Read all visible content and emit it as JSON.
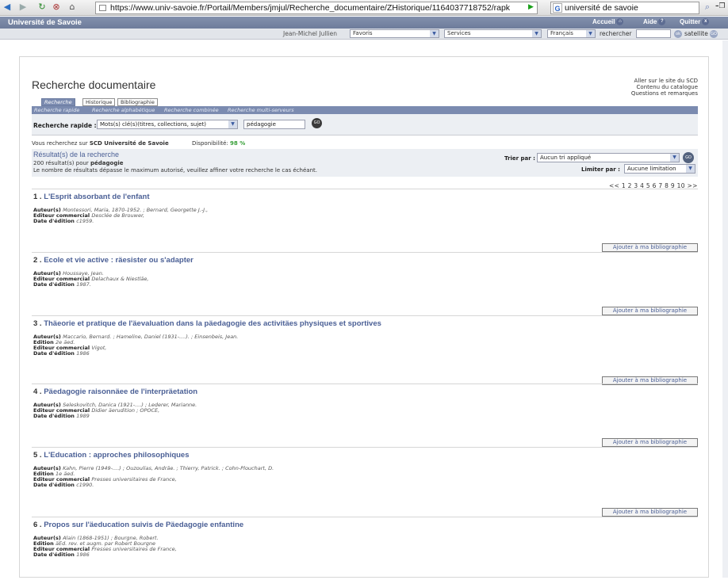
{
  "browser": {
    "url": "https://www.univ-savoie.fr/Portail/Members/jmjul/Recherche_documentaire/ZHistorique/1164037718752/rapk",
    "search_text": "université de savoie"
  },
  "site": {
    "title": "Université de Savoie",
    "links": [
      "Accueil",
      "Aide",
      "Quitter"
    ],
    "user": "Jean-Michel Jullien",
    "favorites": "Favoris",
    "services": "Services",
    "language": "Français",
    "search_label": "rechercher",
    "search_ok": "ok",
    "satellite": "satellite",
    "go": "GO"
  },
  "page": {
    "title": "Recherche documentaire",
    "right_links": [
      "Aller sur le site du SCD",
      "Contenu du catalogue",
      "Questions et remarques"
    ],
    "tabs": [
      "Recherche",
      "Historique",
      "Bibliographie"
    ],
    "subtabs": [
      "Recherche rapide",
      "Recherche alphabétique",
      "Recherche combinée",
      "Recherche multi-serveurs"
    ],
    "quick_label": "Recherche rapide :",
    "quick_select": "Mots(s) clé(s)(titres, collections, sujet)",
    "quick_value": "pédagogie",
    "go": "GO",
    "scope_prefix": "Vous recherchez sur ",
    "scope_name": "SCD Université de Savoie",
    "dispo_label": "Disponibilité:",
    "dispo_value": "98 %",
    "results_heading": "Résultat(s) de la recherche",
    "results_count": "200 résultat(s) pour ",
    "results_term": "pédagogie",
    "results_note": "Le nombre de résultats dépasse le maximum autorisé, veuillez affiner votre recherche le cas échéant.",
    "sort_label": "Trier par :",
    "sort_value": "Aucun tri appliqué",
    "limit_label": "Limiter par :",
    "limit_value": "Aucune limitation",
    "pager": "<< 1 2 3 4 5 6 7 8 9 10 >>",
    "add_label": "Ajouter à ma bibliographie"
  },
  "records": [
    {
      "num": "1 .",
      "title": "L'Esprit absorbant de l'enfant",
      "lines": [
        [
          "Auteur(s) ",
          "Montessori, Maria, 1870-1952. ; Bernard, Georgette J.-J.,"
        ],
        [
          "Editeur commercial ",
          "Desclée de Brouwer,"
        ],
        [
          "Date d'édition ",
          "c1959."
        ]
      ]
    },
    {
      "num": "2 .",
      "title": "Ecole et vie active : räesister ou s'adapter",
      "lines": [
        [
          "Auteur(s) ",
          "Houssaye, Jean."
        ],
        [
          "Editeur commercial ",
          "Delachaux & Niestläe,"
        ],
        [
          "Date d'édition ",
          "1987."
        ]
      ]
    },
    {
      "num": "3 .",
      "title": "Thäeorie et pratique de l'äevaluation dans la päedagogie des activitäes physiques et sportives",
      "lines": [
        [
          "Auteur(s) ",
          "Maccario, Bernard. ; Hameline, Daniel (1931-....). ; Einsenbeis, Jean."
        ],
        [
          "Edition ",
          "2e äed."
        ],
        [
          "Editeur commercial ",
          "Vigot,"
        ],
        [
          "Date d'édition ",
          "1986"
        ]
      ]
    },
    {
      "num": "4 .",
      "title": "Päedagogie raisonnäee de l'interpräetation",
      "lines": [
        [
          "Auteur(s) ",
          "Seleskovitch, Danica (1921-....) ; Lederer, Marianne."
        ],
        [
          "Editeur commercial ",
          "Didier äerudition ; OPOCE,"
        ],
        [
          "Date d'édition ",
          "1989"
        ]
      ]
    },
    {
      "num": "5 .",
      "title": "L'Education : approches philosophiques",
      "lines": [
        [
          "Auteur(s) ",
          "Kahn, Pierre (1949-....) ; Ouzoulias, Andräe. ; Thierry, Patrick. ; Cohn-Plouchart, D."
        ],
        [
          "Edition ",
          "1e äed."
        ],
        [
          "Editeur commercial ",
          "Presses universitaires de France,"
        ],
        [
          "Date d'édition ",
          "c1990."
        ]
      ]
    },
    {
      "num": "6 .",
      "title": "Propos sur l'äeducation suivis de Päedagogie enfantine",
      "lines": [
        [
          "Auteur(s) ",
          "Alain (1868-1951) ; Bourgne, Robert."
        ],
        [
          "Edition ",
          "äEd. rev. et augm. par Robert Bourgne"
        ],
        [
          "Editeur commercial ",
          "Presses universitaires de France,"
        ],
        [
          "Date d'édition ",
          "1986"
        ]
      ]
    }
  ]
}
